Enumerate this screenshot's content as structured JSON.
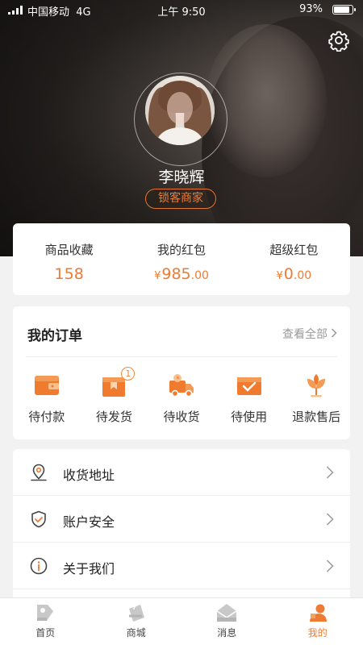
{
  "status_bar": {
    "carrier": "中国移动",
    "network": "4G",
    "time": "上午 9:50",
    "battery": "93%"
  },
  "profile": {
    "name": "李晓辉",
    "tag": "锁客商家"
  },
  "stats": [
    {
      "label": "商品收藏",
      "value": "158",
      "currency": "",
      "decimals": ""
    },
    {
      "label": "我的红包",
      "value": "985",
      "currency": "¥",
      "decimals": ".00"
    },
    {
      "label": "超级红包",
      "value": "0",
      "currency": "¥",
      "decimals": ".00"
    }
  ],
  "orders": {
    "title": "我的订单",
    "view_all": "查看全部",
    "items": [
      {
        "label": "待付款",
        "icon": "wallet-icon"
      },
      {
        "label": "待发货",
        "icon": "package-icon",
        "badge": "1"
      },
      {
        "label": "待收货",
        "icon": "delivery-truck-icon"
      },
      {
        "label": "待使用",
        "icon": "ticket-icon"
      },
      {
        "label": "退款售后",
        "icon": "refund-flower-icon"
      }
    ]
  },
  "menu": [
    {
      "label": "收货地址",
      "icon": "location-icon"
    },
    {
      "label": "账户安全",
      "icon": "shield-icon"
    },
    {
      "label": "关于我们",
      "icon": "info-icon"
    }
  ],
  "tabs": [
    {
      "label": "首页",
      "icon": "home-tag-icon",
      "active": false
    },
    {
      "label": "商城",
      "icon": "shopping-bag-icon",
      "active": false
    },
    {
      "label": "消息",
      "icon": "message-envelope-icon",
      "active": false
    },
    {
      "label": "我的",
      "icon": "user-icon",
      "active": true
    }
  ],
  "colors": {
    "accent": "#ef7a33",
    "accent_light": "#f5a25f",
    "tab_inactive": "#c8c8c8"
  }
}
